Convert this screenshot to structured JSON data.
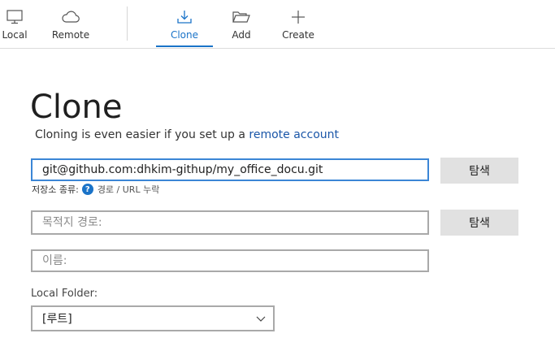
{
  "toolbar": {
    "items": [
      {
        "label": "Local",
        "icon": "monitor-icon"
      },
      {
        "label": "Remote",
        "icon": "cloud-icon"
      },
      {
        "label": "Clone",
        "icon": "download-icon",
        "active": true
      },
      {
        "label": "Add",
        "icon": "folder-open-icon"
      },
      {
        "label": "Create",
        "icon": "plus-icon"
      }
    ]
  },
  "main": {
    "title": "Clone",
    "subtitle_prefix": "Cloning is even easier if you set up a",
    "subtitle_link": "remote account",
    "source": {
      "value": "git@github.com:dhkim-githup/my_office_docu.git",
      "browse_label": "탐색"
    },
    "repo_type": {
      "label": "저장소 종류:",
      "help_icon": "?",
      "status": "경로 / URL 누락"
    },
    "destination": {
      "placeholder": "목적지 경로:",
      "browse_label": "탐색"
    },
    "name": {
      "placeholder": "이름:"
    },
    "local_folder": {
      "label": "Local Folder:",
      "selected": "[루트]"
    }
  },
  "colors": {
    "accent": "#1a73c8",
    "link": "#1a56a8",
    "button_bg": "#e1e1e1"
  }
}
